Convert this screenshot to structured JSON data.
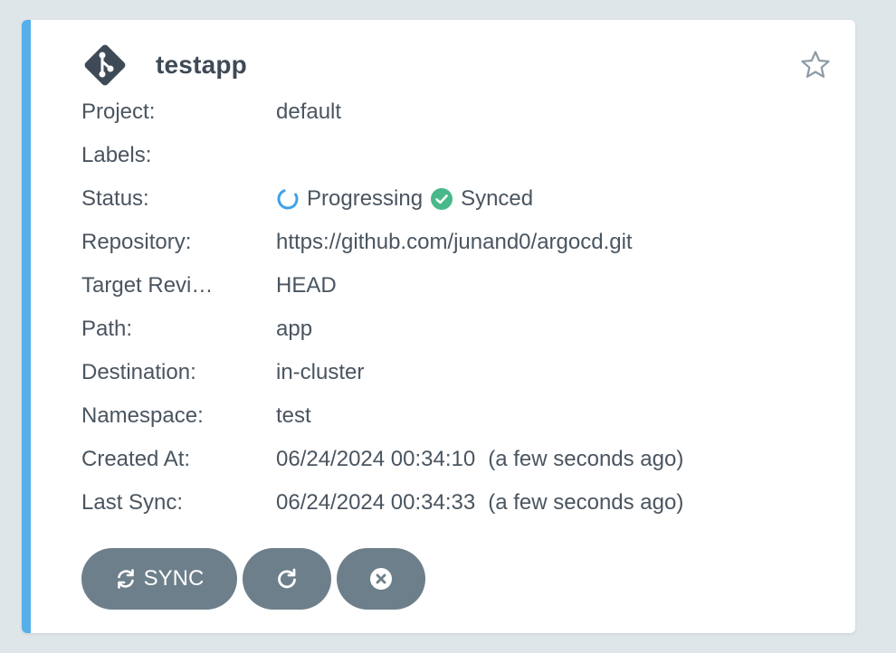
{
  "app": {
    "name": "testapp",
    "icon": "git-icon",
    "accent_color": "#55b0ea"
  },
  "fields": {
    "project": {
      "label": "Project:",
      "value": "default"
    },
    "labels": {
      "label": "Labels:",
      "value": ""
    },
    "status": {
      "label": "Status:",
      "health": {
        "text": "Progressing",
        "icon": "progressing-spinner-icon",
        "color": "#3ea1ea"
      },
      "sync": {
        "text": "Synced",
        "icon": "check-circle-icon",
        "color": "#47b98b"
      }
    },
    "repository": {
      "label": "Repository:",
      "value": "https://github.com/junand0/argocd.git"
    },
    "target_revision": {
      "label": "Target Revi…",
      "value": "HEAD"
    },
    "path": {
      "label": "Path:",
      "value": "app"
    },
    "destination": {
      "label": "Destination:",
      "value": "in-cluster"
    },
    "namespace": {
      "label": "Namespace:",
      "value": "test"
    },
    "created_at": {
      "label": "Created At:",
      "value": "06/24/2024 00:34:10",
      "relative": "(a few seconds ago)"
    },
    "last_sync": {
      "label": "Last Sync:",
      "value": "06/24/2024 00:34:33",
      "relative": "(a few seconds ago)"
    }
  },
  "actions": {
    "sync_label": "SYNC",
    "sync_icon": "sync-icon",
    "refresh_icon": "refresh-icon",
    "delete_icon": "close-circle-icon",
    "button_color": "#6d7f8b"
  },
  "favorite_icon": "star-outline-icon"
}
